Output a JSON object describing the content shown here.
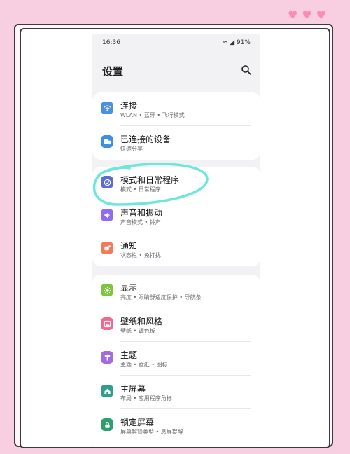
{
  "status_bar": {
    "time": "16:36",
    "battery": "91%"
  },
  "header": {
    "title": "设置"
  },
  "groups": [
    {
      "items": [
        {
          "title": "连接",
          "subtitle": "WLAN • 蓝牙 • 飞行模式",
          "icon": "wifi-icon",
          "color": "#4a90e2"
        },
        {
          "title": "已连接的设备",
          "subtitle": "快速分享",
          "icon": "devices-icon",
          "color": "#3d8fe0"
        }
      ]
    },
    {
      "items": [
        {
          "title": "模式和日常程序",
          "subtitle": "模式 • 日常程序",
          "icon": "check-circle-icon",
          "color": "#5a6cd6"
        },
        {
          "title": "声音和振动",
          "subtitle": "声音模式 • 铃声",
          "icon": "speaker-icon",
          "color": "#8e6cf0"
        },
        {
          "title": "通知",
          "subtitle": "状态栏 • 免打扰",
          "icon": "notification-icon",
          "color": "#f07a5a"
        }
      ]
    },
    {
      "items": [
        {
          "title": "显示",
          "subtitle": "亮度 • 眼睛舒适度保护 • 导航条",
          "icon": "sun-icon",
          "color": "#7cc63c"
        },
        {
          "title": "壁纸和风格",
          "subtitle": "壁纸 • 调色板",
          "icon": "wallpaper-icon",
          "color": "#f06a8e"
        },
        {
          "title": "主题",
          "subtitle": "主题 • 壁纸 • 图标",
          "icon": "theme-icon",
          "color": "#a46ae0"
        },
        {
          "title": "主屏幕",
          "subtitle": "布局 • 应用程序角标",
          "icon": "home-icon",
          "color": "#2e9e8e"
        },
        {
          "title": "锁定屏幕",
          "subtitle": "屏幕解锁类型 • 息屏提醒",
          "icon": "lock-icon",
          "color": "#2e9e6e"
        }
      ]
    }
  ],
  "annotation_color": "#6fe6dc"
}
